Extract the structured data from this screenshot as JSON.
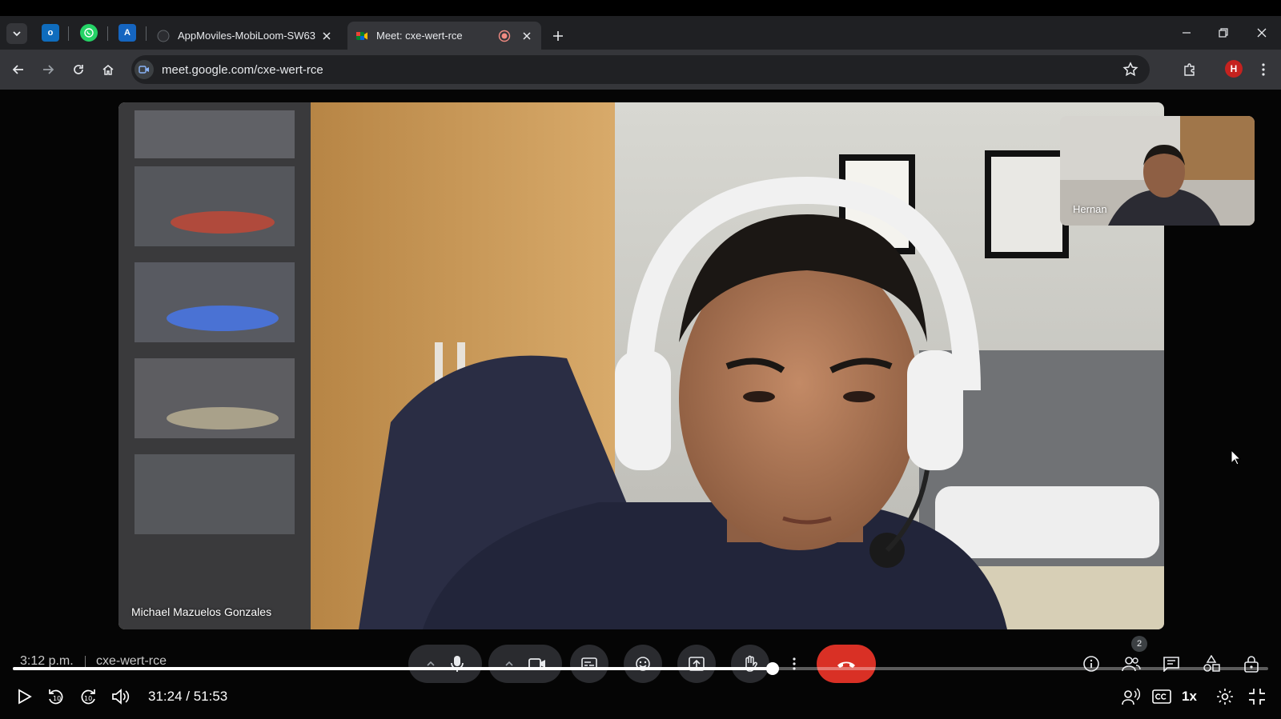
{
  "browser": {
    "tabs": [
      {
        "title": "AppMoviles-MobiLoom-SW63/",
        "active": false
      },
      {
        "title": "Meet: cxe-wert-rce",
        "active": true
      }
    ],
    "url": "meet.google.com/cxe-wert-rce",
    "profile_initial": "H",
    "pinned_icons": [
      "outlook-icon",
      "whatsapp-icon",
      "app-a-icon"
    ]
  },
  "meet": {
    "main_participant": "Michael Mazuelos Gonzales",
    "self_participant": "Hernan",
    "clock": "3:12 p.m.",
    "meeting_code": "cxe-wert-rce",
    "participant_count": "2"
  },
  "player": {
    "current_time": "31:24",
    "total_time": "51:53",
    "time_display": "31:24 / 51:53",
    "progress_fraction": 0.605,
    "speed": "1x"
  },
  "colors": {
    "accent": "#1a73e8",
    "end_call": "#d93025",
    "tab_active": "#35363a",
    "tabstrip": "#1f2023"
  }
}
